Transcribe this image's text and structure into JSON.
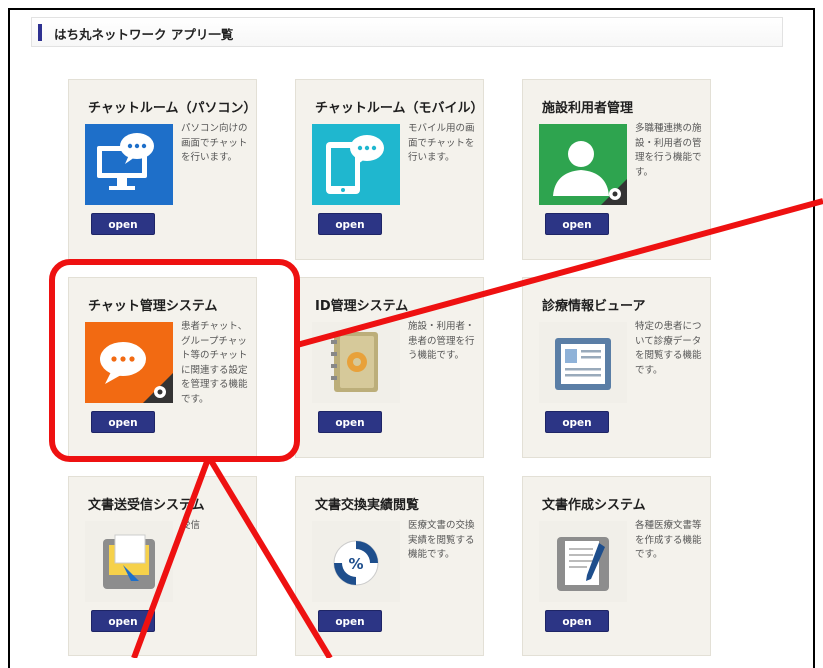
{
  "header": {
    "title": "はち丸ネットワーク アプリ一覧"
  },
  "colors": {
    "accent": "#2e3191",
    "button": "#2c3585",
    "annotation": "#ee1111",
    "card_bg": "#f4f2ec"
  },
  "cards": [
    {
      "title": "チャットルーム（パソコン）",
      "description": "パソコン向けの画面でチャットを行います。",
      "button": "open",
      "icon": "desktop-chat-icon"
    },
    {
      "title": "チャットルーム（モバイル）",
      "description": "モバイル用の画面でチャットを行います。",
      "button": "open",
      "icon": "tablet-chat-icon"
    },
    {
      "title": "施設利用者管理",
      "description": "多職種連携の施設・利用者の管理を行う機能です。",
      "button": "open",
      "icon": "user-admin-icon"
    },
    {
      "title": "チャット管理システム",
      "description": "患者チャット、グループチャット等のチャットに関連する設定を管理する機能です。",
      "button": "open",
      "icon": "chat-settings-icon"
    },
    {
      "title": "ID管理システム",
      "description": "施設・利用者・患者の管理を行う機能です。",
      "button": "open",
      "icon": "address-book-icon"
    },
    {
      "title": "診療情報ビューア",
      "description": "特定の患者について診療データを閲覧する機能です。",
      "button": "open",
      "icon": "record-viewer-icon"
    },
    {
      "title": "文書送受信システム",
      "description": "受信",
      "button": "open",
      "icon": "document-send-icon"
    },
    {
      "title": "文書交換実績閲覧",
      "description": "医療文書の交換実績を閲覧する機能です。",
      "button": "open",
      "icon": "exchange-stats-icon"
    },
    {
      "title": "文書作成システム",
      "description": "各種医療文書等を作成する機能です。",
      "button": "open",
      "icon": "document-create-icon"
    }
  ]
}
